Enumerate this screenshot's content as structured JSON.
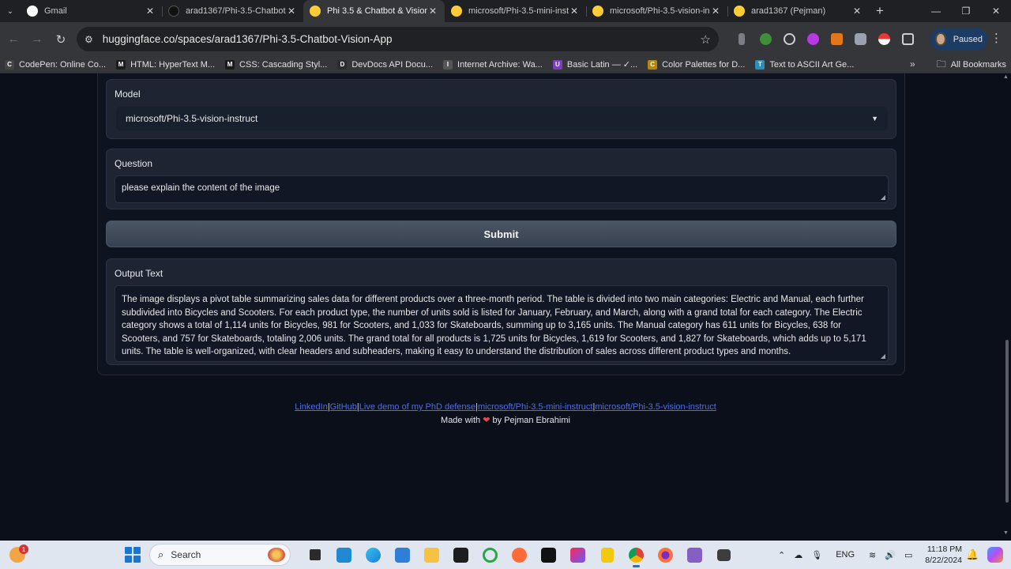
{
  "browser": {
    "tabs": [
      {
        "title": "Gmail",
        "favicon": "google-icon",
        "active": false
      },
      {
        "title": "arad1367/Phi-3.5-Chatbot",
        "favicon": "github-icon",
        "active": false
      },
      {
        "title": "Phi 3.5 & Chatbot & Vision",
        "favicon": "huggingface-icon",
        "active": true
      },
      {
        "title": "microsoft/Phi-3.5-mini-inst",
        "favicon": "huggingface-icon",
        "active": false
      },
      {
        "title": "microsoft/Phi-3.5-vision-in",
        "favicon": "huggingface-icon",
        "active": false
      },
      {
        "title": "arad1367 (Pejman)",
        "favicon": "huggingface-icon",
        "active": false
      }
    ],
    "url": "huggingface.co/spaces/arad1367/Phi-3.5-Chatbot-Vision-App",
    "profile_label": "Paused",
    "bookmarks": [
      {
        "label": "CodePen: Online Co...",
        "color": "#444444",
        "glyph": "C"
      },
      {
        "label": "HTML: HyperText M...",
        "color": "#1b1b1b",
        "glyph": "M"
      },
      {
        "label": "CSS: Cascading Styl...",
        "color": "#1b1b1b",
        "glyph": "M"
      },
      {
        "label": "DevDocs API Docu...",
        "color": "#2c2c2c",
        "glyph": "D"
      },
      {
        "label": "Internet Archive: Wa...",
        "color": "#555555",
        "glyph": "I"
      },
      {
        "label": "Basic Latin — ✓...",
        "color": "#7b3fb8",
        "glyph": "U"
      },
      {
        "label": "Color Palettes for D...",
        "color": "#b8860b",
        "glyph": "C"
      },
      {
        "label": "Text to ASCII Art Ge...",
        "color": "#2a8fbd",
        "glyph": "T"
      }
    ],
    "all_bookmarks_label": "All Bookmarks"
  },
  "app": {
    "model": {
      "label": "Model",
      "value": "microsoft/Phi-3.5-vision-instruct"
    },
    "question": {
      "label": "Question",
      "value": "please explain the content of the image"
    },
    "submit_label": "Submit",
    "output": {
      "label": "Output Text",
      "value": "The image displays a pivot table summarizing sales data for different products over a three-month period. The table is divided into two main categories: Electric and Manual, each further subdivided into Bicycles and Scooters. For each product type, the number of units sold is listed for January, February, and March, along with a grand total for each category. The Electric category shows a total of 1,114 units for Bicycles, 981 for Scooters, and 1,033 for Skateboards, summing up to 3,165 units. The Manual category has 611 units for Bicycles, 638 for Scooters, and 757 for Skateboards, totaling 2,006 units. The grand total for all products is 1,725 units for Bicycles, 1,619 for Scooters, and 1,827 for Skateboards, which adds up to 5,171 units. The table is well-organized, with clear headers and subheaders, making it easy to understand the distribution of sales across different product types and months."
    }
  },
  "footer": {
    "links": [
      "LinkedIn",
      "GitHub",
      "Live demo of my PhD defense",
      "microsoft/Phi-3.5-mini-instruct",
      "microsoft/Phi-3.5-vision-instruct"
    ],
    "separator": "|",
    "made_with_prefix": "Made with",
    "heart": "❤",
    "made_with_suffix": "by Pejman Ebrahimi"
  },
  "taskbar": {
    "search_placeholder": "Search",
    "widget_badge": "1",
    "language": "ENG",
    "time": "11:18 PM",
    "date": "8/22/2024"
  }
}
